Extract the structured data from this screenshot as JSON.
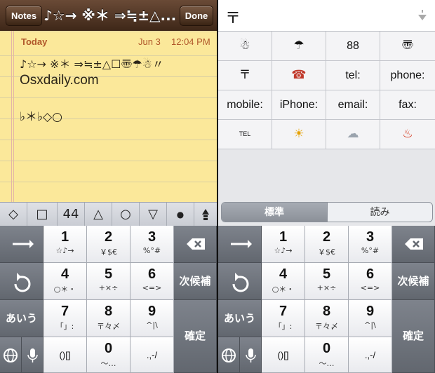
{
  "notes": {
    "back_label": "Notes",
    "done_label": "Done",
    "title": "♪☆→ ※＊ ⇒≒±△...",
    "date_label": "Today",
    "day": "Jun 3",
    "time": "12:04 PM",
    "lines": [
      "♪☆→ ※＊  ⇒≒±△☐〠☂☃〃",
      "Osxdaily.com",
      "♭＊♭◇○"
    ]
  },
  "suggestions": [
    "◇",
    "□",
    "44",
    "△",
    "○",
    "▽",
    "●"
  ],
  "candidate_panel": {
    "input_text": "〒",
    "cells": [
      [
        "☃",
        "☂",
        "88",
        "〠"
      ],
      [
        "〒",
        "☎",
        "tel:",
        "phone:"
      ],
      [
        "mobile:",
        "iPhone:",
        "email:",
        "fax:"
      ],
      [
        "TEL",
        "☀",
        "☁",
        "♨"
      ]
    ],
    "segment_selected": "標準",
    "segment_other": "読み"
  },
  "keyboard": {
    "keys": [
      {
        "main": "1",
        "sub": "☆♪→"
      },
      {
        "main": "2",
        "sub": "￥$€"
      },
      {
        "main": "3",
        "sub": "%°#"
      },
      {
        "main": "4",
        "sub": "○＊・"
      },
      {
        "main": "5",
        "sub": "+×÷"
      },
      {
        "main": "6",
        "sub": "<=>"
      },
      {
        "main": "7",
        "sub": "「」:"
      },
      {
        "main": "8",
        "sub": "〒々〆"
      },
      {
        "main": "9",
        "sub": "^|\\"
      },
      {
        "main": "0",
        "sub": "〜…"
      }
    ],
    "bottom_left": "()[]",
    "bottom_right": ".,-/",
    "kana_label": "あいう",
    "convert_label": "次候補",
    "confirm_label": "確定"
  },
  "colors": {
    "notes_bar": "#4a2f1f",
    "paper": "#fbe89a",
    "date_text": "#b0572a",
    "dark_key": "#6f747c"
  }
}
